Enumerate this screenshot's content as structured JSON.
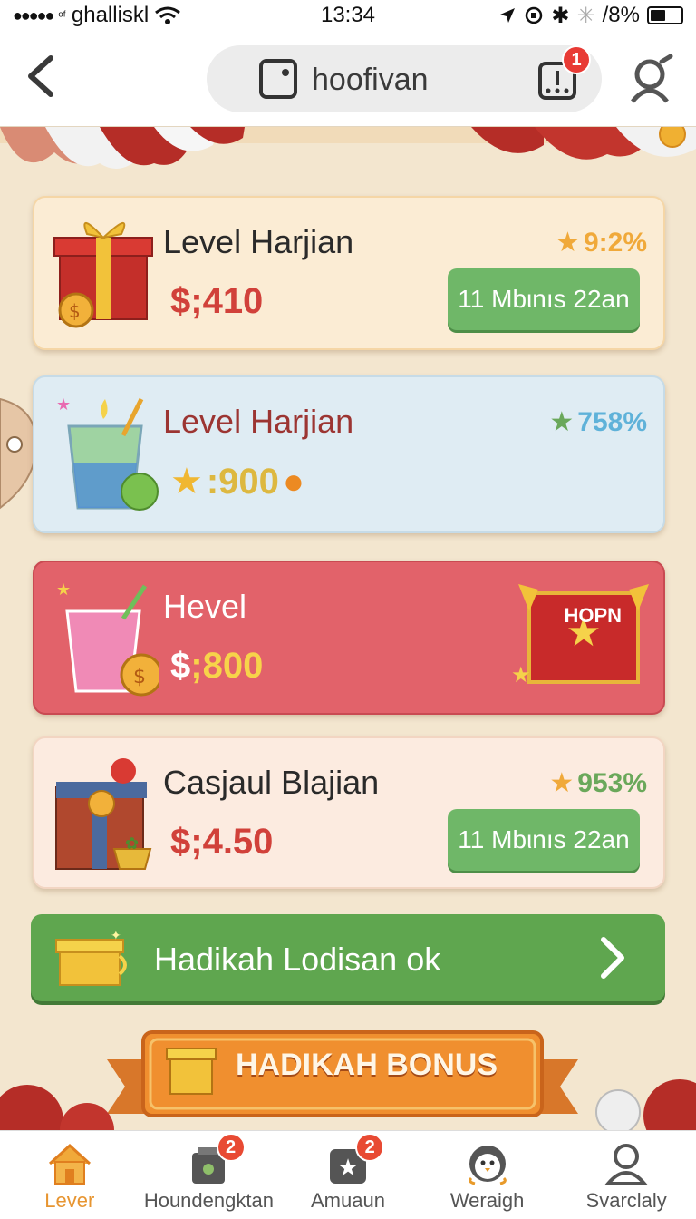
{
  "status_bar": {
    "carrier": "ghalliskl",
    "carrier_prefix": "ᵒᶠ",
    "time": "13:34",
    "battery": "/8%"
  },
  "nav": {
    "back_icon": "chevron-left-icon",
    "title": "hoofivan",
    "alert_badge": "1",
    "profile_icon": "user-icon"
  },
  "cards": [
    {
      "title": "Level Harjian",
      "price": "$;410",
      "rating": "9:2%",
      "rating_color": "#f0a93a",
      "button": "11 Mbιnıs 22an"
    },
    {
      "title": "Level Harjian",
      "price": ":900",
      "rating": "758%",
      "rating_color": "#5fb2d9"
    },
    {
      "title": "Hevel",
      "price_symbol": "$",
      "price_value": ";800",
      "banner": "HOPN"
    },
    {
      "title": "Casjaul Blajian",
      "price": "$;4.50",
      "rating": "953%",
      "rating_color": "#6aa85a",
      "button": "11 Mbιnıs 22an"
    }
  ],
  "promo_bar": {
    "label": "Hadikah Lodisan ok"
  },
  "bonus": {
    "label": "HADIKAH BONUS"
  },
  "tabs": [
    {
      "label": "Lever",
      "icon": "home-icon",
      "active": true
    },
    {
      "label": "Houndengktan",
      "icon": "basket-icon",
      "badge": "2"
    },
    {
      "label": "Amuaun",
      "icon": "star-box-icon",
      "badge": "2"
    },
    {
      "label": "Weraigh",
      "icon": "penguin-icon"
    },
    {
      "label": "Svarclaly",
      "icon": "user-icon"
    }
  ],
  "colors": {
    "accent_green": "#6fb768",
    "alert_red": "#e83b35",
    "active_tab": "#e79531"
  }
}
